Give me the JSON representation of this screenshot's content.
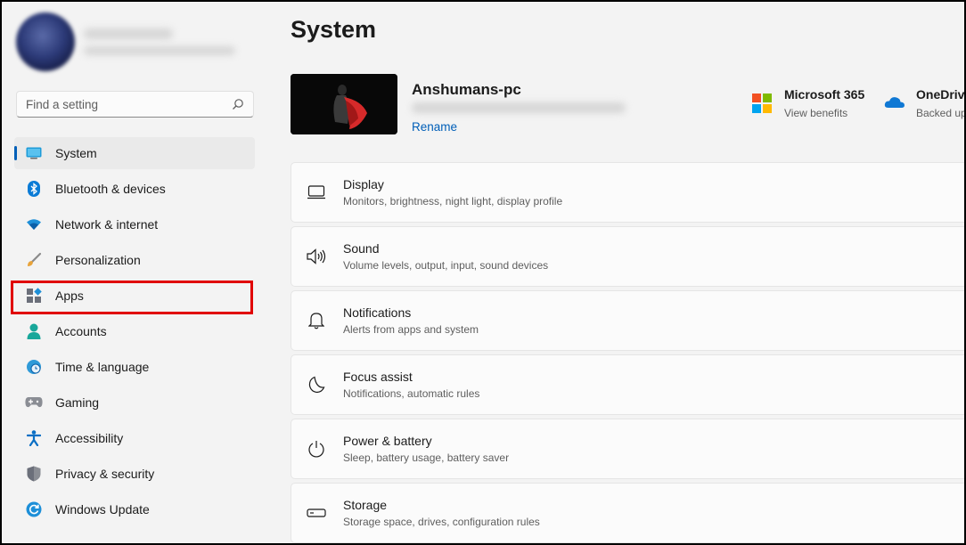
{
  "search": {
    "placeholder": "Find a setting"
  },
  "sidebar": {
    "items": [
      {
        "label": "System",
        "icon": "system-icon"
      },
      {
        "label": "Bluetooth & devices",
        "icon": "bluetooth-icon"
      },
      {
        "label": "Network & internet",
        "icon": "wifi-icon"
      },
      {
        "label": "Personalization",
        "icon": "brush-icon"
      },
      {
        "label": "Apps",
        "icon": "apps-icon"
      },
      {
        "label": "Accounts",
        "icon": "person-icon"
      },
      {
        "label": "Time & language",
        "icon": "clock-globe-icon"
      },
      {
        "label": "Gaming",
        "icon": "gamepad-icon"
      },
      {
        "label": "Accessibility",
        "icon": "accessibility-icon"
      },
      {
        "label": "Privacy & security",
        "icon": "shield-icon"
      },
      {
        "label": "Windows Update",
        "icon": "update-icon"
      }
    ],
    "selected": "System",
    "highlighted": "Apps"
  },
  "main": {
    "title": "System",
    "pc": {
      "name": "Anshumans-pc",
      "rename_label": "Rename"
    },
    "services": [
      {
        "title": "Microsoft 365",
        "subtitle": "View benefits",
        "icon": "microsoft-logo-icon"
      },
      {
        "title": "OneDrive",
        "subtitle": "Backed up",
        "icon": "onedrive-icon"
      }
    ],
    "cards": [
      {
        "title": "Display",
        "subtitle": "Monitors, brightness, night light, display profile",
        "icon": "monitor-icon"
      },
      {
        "title": "Sound",
        "subtitle": "Volume levels, output, input, sound devices",
        "icon": "speaker-icon"
      },
      {
        "title": "Notifications",
        "subtitle": "Alerts from apps and system",
        "icon": "bell-icon"
      },
      {
        "title": "Focus assist",
        "subtitle": "Notifications, automatic rules",
        "icon": "moon-icon"
      },
      {
        "title": "Power & battery",
        "subtitle": "Sleep, battery usage, battery saver",
        "icon": "power-icon"
      },
      {
        "title": "Storage",
        "subtitle": "Storage space, drives, configuration rules",
        "icon": "storage-icon"
      }
    ]
  },
  "colors": {
    "accent": "#005fb8",
    "highlight": "#e00000",
    "background": "#f3f3f3"
  }
}
